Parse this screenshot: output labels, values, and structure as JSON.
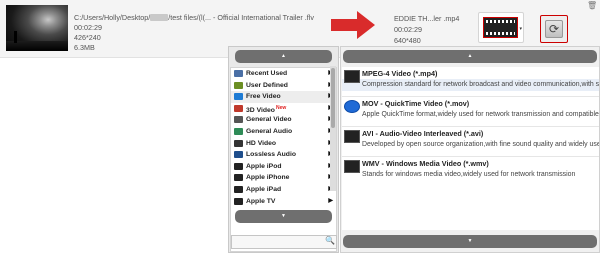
{
  "source_file": {
    "name_start": "C:/Users/Holly/Desktop/",
    "name_end": "/test files/(l(... - Official International Trailer .flv",
    "duration": "00:02:29",
    "resolution": "426*240",
    "size": "6.3MB"
  },
  "output_file": {
    "name": "EDDIE TH...ler .mp4",
    "duration": "00:02:29",
    "resolution": "640*480"
  },
  "categories": [
    {
      "label": "Recent Used",
      "icon": "recent-icon",
      "color": "#4a6fa5"
    },
    {
      "label": "User Defined",
      "icon": "user-icon",
      "color": "#6b8e23"
    },
    {
      "label": "Free Video",
      "icon": "free-video-icon",
      "color": "#1e7bd4",
      "selected": true
    },
    {
      "label": "3D Video",
      "icon": "3d-icon",
      "color": "#c0392b",
      "badge": "New"
    },
    {
      "label": "General Video",
      "icon": "film-icon",
      "color": "#555555"
    },
    {
      "label": "General Audio",
      "icon": "music-icon",
      "color": "#2e8b57"
    },
    {
      "label": "HD Video",
      "icon": "hd-icon",
      "color": "#333333"
    },
    {
      "label": "Lossless Audio",
      "icon": "audio-icon",
      "color": "#1f4e8c"
    },
    {
      "label": "Apple iPod",
      "icon": "apple-icon",
      "color": "#222222"
    },
    {
      "label": "Apple iPhone",
      "icon": "apple-icon",
      "color": "#222222"
    },
    {
      "label": "Apple iPad",
      "icon": "apple-icon",
      "color": "#222222"
    },
    {
      "label": "Apple TV",
      "icon": "apple-icon",
      "color": "#222222"
    }
  ],
  "formats": [
    {
      "title": "MPEG-4 Video (*.mp4)",
      "desc": "Compression standard for network broadcast and video communication,with small size",
      "icon": "mp4-film-icon",
      "selected": true
    },
    {
      "title": "MOV - QuickTime Video (*.mov)",
      "desc": "Apple QuickTime format,widely used for network transmission and compatible with Apple",
      "icon": "quicktime-icon"
    },
    {
      "title": "AVI - Audio-Video Interleaved (*.avi)",
      "desc": "Developed by open source organization,with fine sound quality and widely used",
      "icon": "avi-film-icon"
    },
    {
      "title": "WMV - Windows Media Video (*.wmv)",
      "desc": "Stands for windows media video,widely used for network transmission",
      "icon": "wmv-film-icon"
    }
  ],
  "buttons": {
    "up_arrow": "▲",
    "down_arrow": "▼",
    "right_arrow": "▶",
    "refresh": "⟳",
    "trash": "🗑",
    "search": "🔍",
    "dropdown": "▾"
  },
  "search": {
    "value": "",
    "placeholder": ""
  },
  "colors": {
    "accent_red": "#d92b2b",
    "scroll_button": "#6f6f6f",
    "selected_bg": "#ededed"
  }
}
